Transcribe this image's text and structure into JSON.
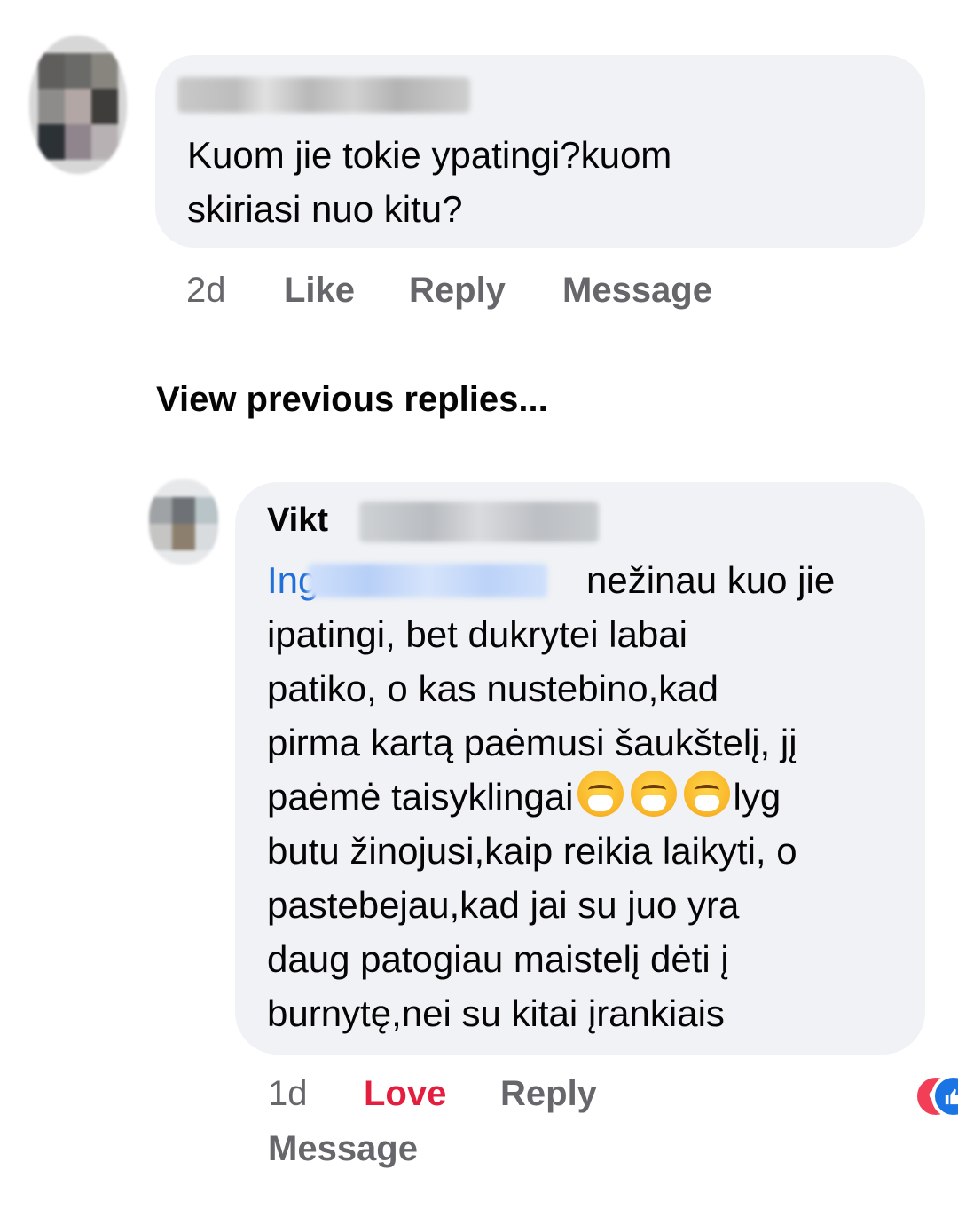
{
  "top_cutoff": {
    "text": "...",
    "link": ""
  },
  "comments": [
    {
      "author": "",
      "text": "Kuom jie tokie ypatingi?kuom\nskiriasi nuo kitu?",
      "time": "2d",
      "like_label": "Like",
      "reply_label": "Reply",
      "message_label": "Message"
    },
    {
      "author_visible": "Vikt",
      "mention_visible": "Ing",
      "text_first_line": "nežinau kuo jie",
      "text_body": "ipatingi, bet dukrytei labai\npatiko, o kas nustebino,kad\npirma kartą paėmusi šaukštelį, jį\npaėmė taisyklingai",
      "text_after_emoji": "lyg\nbutu žinojusi,kaip reikia laikyti, o\npastebejau,kad jai su juo yra\ndaug patogiau maistelį dėti į\nburnytę,nei su kitai įrankiais",
      "emoji_icon": "face-with-hand-over-mouth-icon",
      "time": "1d",
      "love_label": "Love",
      "reply_label": "Reply",
      "message_label": "Message",
      "reaction_count": "2",
      "reaction_icons": [
        "like-icon",
        "heart-icon"
      ]
    }
  ],
  "view_previous": "View previous replies...",
  "colors": {
    "bubble_bg": "#f0f2f5",
    "link_blue": "#216fdb",
    "meta_gray": "#65676b",
    "love_red": "#e41e3f",
    "like_blue": "#1b74e4",
    "heart_red": "#f33e58"
  }
}
